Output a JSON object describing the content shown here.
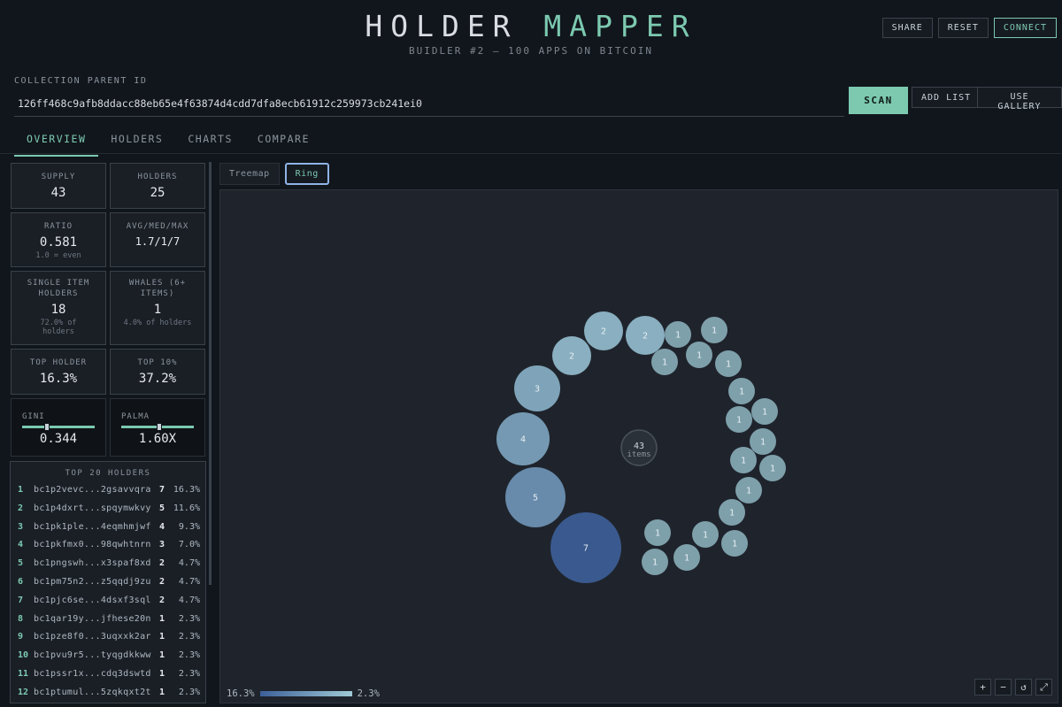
{
  "header": {
    "title_main": "HOLDER ",
    "title_accent": "MAPPER",
    "subtitle": "BUIDLER #2 — 100 APPS ON BITCOIN",
    "share_label": "SHARE",
    "reset_label": "RESET",
    "connect_label": "CONNECT"
  },
  "collection": {
    "label": "COLLECTION PARENT ID",
    "value": "126ff468c9afb8ddacc88eb65e4f63874d4cdd7dfa8ecb61912c259973cb241ei0",
    "scan_label": "SCAN",
    "add_list_label": "ADD LIST",
    "use_gallery_label": "USE GALLERY"
  },
  "tabs": [
    "OVERVIEW",
    "HOLDERS",
    "CHARTS",
    "COMPARE"
  ],
  "active_tab": "OVERVIEW",
  "stats": {
    "supply": {
      "label": "SUPPLY",
      "value": "43"
    },
    "holders": {
      "label": "HOLDERS",
      "value": "25"
    },
    "ratio": {
      "label": "RATIO",
      "value": "0.581",
      "sub": "1.0 = even"
    },
    "avg": {
      "label": "AVG/MED/MAX",
      "value": "1.7/1/7"
    },
    "single": {
      "label_1": "SINGLE ITEM",
      "label_2": "HOLDERS",
      "value": "18",
      "sub_1": "72.0% of",
      "sub_2": "holders"
    },
    "whales": {
      "label_1": "WHALES (6+",
      "label_2": "ITEMS)",
      "value": "1",
      "sub": "4.0% of holders"
    },
    "top_holder": {
      "label": "TOP HOLDER",
      "value": "16.3%"
    },
    "top10": {
      "label": "TOP 10%",
      "value": "37.2%"
    },
    "gini": {
      "label": "GINI",
      "value": "0.344",
      "level": 0.344
    },
    "palma": {
      "label": "PALMA",
      "value": "1.60X",
      "level": 0.53
    }
  },
  "top_holders": {
    "title": "TOP 20 HOLDERS",
    "rows": [
      {
        "rank": "1",
        "addr": "bc1p2vevc...2gsavvqra",
        "count": "7",
        "pct": "16.3%"
      },
      {
        "rank": "2",
        "addr": "bc1p4dxrt...spqymwkvy",
        "count": "5",
        "pct": "11.6%"
      },
      {
        "rank": "3",
        "addr": "bc1pk1ple...4eqmhmjwf",
        "count": "4",
        "pct": "9.3%"
      },
      {
        "rank": "4",
        "addr": "bc1pkfmx0...98qwhtnrn",
        "count": "3",
        "pct": "7.0%"
      },
      {
        "rank": "5",
        "addr": "bc1pngswh...x3spaf8xd",
        "count": "2",
        "pct": "4.7%"
      },
      {
        "rank": "6",
        "addr": "bc1pm75n2...z5qqdj9zu",
        "count": "2",
        "pct": "4.7%"
      },
      {
        "rank": "7",
        "addr": "bc1pjc6se...4dsxf3sql",
        "count": "2",
        "pct": "4.7%"
      },
      {
        "rank": "8",
        "addr": "bc1qar19y...jfhese20n",
        "count": "1",
        "pct": "2.3%"
      },
      {
        "rank": "9",
        "addr": "bc1pze8f0...3uqxxk2ar",
        "count": "1",
        "pct": "2.3%"
      },
      {
        "rank": "10",
        "addr": "bc1pvu9r5...tyqgdkkww",
        "count": "1",
        "pct": "2.3%"
      },
      {
        "rank": "11",
        "addr": "bc1pssr1x...cdq3dswtd",
        "count": "1",
        "pct": "2.3%"
      },
      {
        "rank": "12",
        "addr": "bc1ptumul...5zqkqxt2t",
        "count": "1",
        "pct": "2.3%"
      }
    ]
  },
  "view_tabs": {
    "treemap": "Treemap",
    "ring": "Ring",
    "active": "Ring"
  },
  "ring": {
    "center_count": "43",
    "center_label": "items",
    "holder_counts": [
      7,
      5,
      4,
      3,
      2,
      2,
      2,
      1,
      1,
      1,
      1,
      1,
      1,
      1,
      1,
      1,
      1,
      1,
      1,
      1,
      1,
      1,
      1,
      1,
      1
    ],
    "color_high": "#3d5f99",
    "color_low": "#9fcad6"
  },
  "legend": {
    "max": "16.3%",
    "min": "2.3%"
  },
  "zoom": {
    "in": "+",
    "out": "−",
    "reset": "↺",
    "fit": "⤢"
  }
}
